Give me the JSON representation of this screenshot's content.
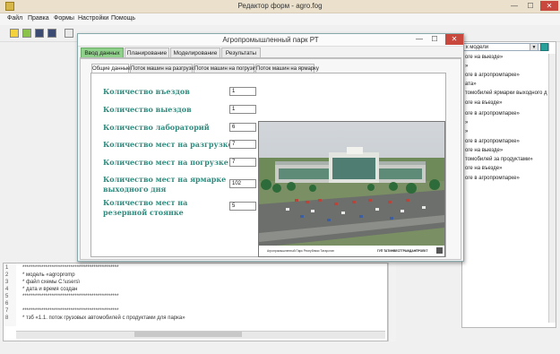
{
  "app": {
    "title": "Редактор форм - agro.fog",
    "menu": [
      "Файл",
      "Правка",
      "Формы",
      "Настройки",
      "Помощь"
    ],
    "window_buttons": [
      "—",
      "☐",
      "✕"
    ]
  },
  "right_panel": {
    "combo_value": "к модели",
    "lines": [
      "оге на выезде»",
      "»",
      "оге в агропромпарке»",
      "ата»",
      "томобилей ярмарки выходного д",
      "оге на въезде»",
      "оге в агропромпарке»",
      "»",
      "»",
      "оге в агропромпарке»",
      "оге на выезде»",
      "томобилей за продуктами»",
      "оге на въезде»",
      "оге в агропромпарке»"
    ]
  },
  "log": {
    "line_numbers": [
      "1",
      "2",
      "3",
      "4",
      "5",
      "6",
      "7",
      "8"
    ],
    "lines": [
      "**********************************************",
      "* модель «agropromp",
      "* файл схемы C:\\users\\",
      "* дата и время создан",
      "**********************************************",
      "",
      "**********************************************",
      "* тзб «1.1. поток грузовых автомобилей с продуктами для парка»"
    ]
  },
  "dialog": {
    "title": "Агропромышленный парк РТ",
    "buttons": [
      "—",
      "☐",
      "✕"
    ],
    "tabs": [
      "Ввод данных",
      "Планирование",
      "Моделирование",
      "Результаты"
    ],
    "subtabs": [
      "Общие данные",
      "Поток машин на разгрузку",
      "Поток машин на погрузку",
      "Поток машин на ярмарку"
    ],
    "fields": [
      {
        "label": "Количество въездов",
        "value": "1"
      },
      {
        "label": "Количество выездов",
        "value": "1"
      },
      {
        "label": "Количество лабораторий",
        "value": "6"
      },
      {
        "label": "Количество мест на разгрузке",
        "value": "7"
      },
      {
        "label": "Количество мест на погрузке",
        "value": "7"
      },
      {
        "label": "Количество мест на ярмарке",
        "label2": "выходного дня",
        "value": "102"
      },
      {
        "label": "Количество мест на",
        "label2": "резервной стоянке",
        "value": "5"
      }
    ],
    "photo_caption_left": "Агропромышленный Парк Республики Татарстан",
    "photo_caption_right": "ГУП ТАТИНВЕСТГРАЖДАНПРОЕКТ"
  }
}
